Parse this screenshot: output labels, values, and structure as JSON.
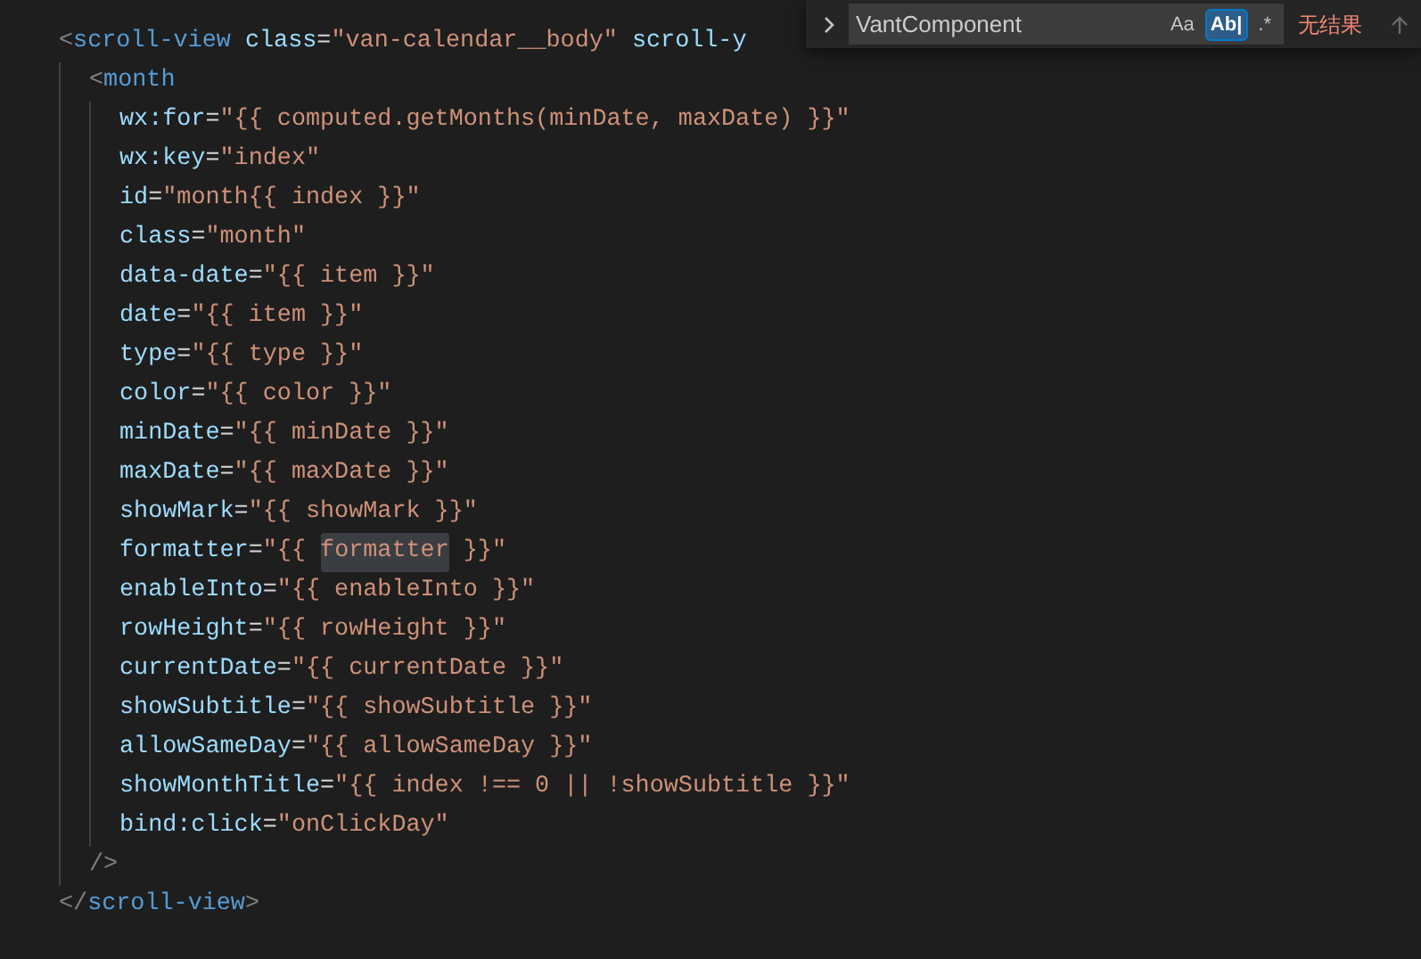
{
  "editor": {
    "lines": [
      {
        "tokens": [
          {
            "kind": "punct",
            "text": "<"
          },
          {
            "kind": "tag",
            "text": "scroll-view"
          },
          {
            "kind": "attr",
            "text": " class"
          },
          {
            "kind": "plain",
            "text": "="
          },
          {
            "kind": "string",
            "text": "\"van-calendar__body\""
          },
          {
            "kind": "attr",
            "text": " scroll-y"
          }
        ],
        "children": [
          {
            "tokens": [
              {
                "kind": "punct",
                "text": "<"
              },
              {
                "kind": "tag",
                "text": "month"
              }
            ],
            "children": [
              {
                "tokens": [
                  {
                    "kind": "attr",
                    "text": "wx:for"
                  },
                  {
                    "kind": "plain",
                    "text": "="
                  },
                  {
                    "kind": "string",
                    "text": "\"{{ computed.getMonths(minDate, maxDate) }}\""
                  }
                ]
              },
              {
                "tokens": [
                  {
                    "kind": "attr",
                    "text": "wx:key"
                  },
                  {
                    "kind": "plain",
                    "text": "="
                  },
                  {
                    "kind": "string",
                    "text": "\"index\""
                  }
                ]
              },
              {
                "tokens": [
                  {
                    "kind": "attr",
                    "text": "id"
                  },
                  {
                    "kind": "plain",
                    "text": "="
                  },
                  {
                    "kind": "string",
                    "text": "\"month{{ index }}\""
                  }
                ]
              },
              {
                "tokens": [
                  {
                    "kind": "attr",
                    "text": "class"
                  },
                  {
                    "kind": "plain",
                    "text": "="
                  },
                  {
                    "kind": "string",
                    "text": "\"month\""
                  }
                ]
              },
              {
                "tokens": [
                  {
                    "kind": "attr",
                    "text": "data-date"
                  },
                  {
                    "kind": "plain",
                    "text": "="
                  },
                  {
                    "kind": "string",
                    "text": "\"{{ item }}\""
                  }
                ]
              },
              {
                "tokens": [
                  {
                    "kind": "attr",
                    "text": "date"
                  },
                  {
                    "kind": "plain",
                    "text": "="
                  },
                  {
                    "kind": "string",
                    "text": "\"{{ item }}\""
                  }
                ]
              },
              {
                "tokens": [
                  {
                    "kind": "attr",
                    "text": "type"
                  },
                  {
                    "kind": "plain",
                    "text": "="
                  },
                  {
                    "kind": "string",
                    "text": "\"{{ type }}\""
                  }
                ]
              },
              {
                "tokens": [
                  {
                    "kind": "attr",
                    "text": "color"
                  },
                  {
                    "kind": "plain",
                    "text": "="
                  },
                  {
                    "kind": "string",
                    "text": "\"{{ color }}\""
                  }
                ]
              },
              {
                "tokens": [
                  {
                    "kind": "attr",
                    "text": "minDate"
                  },
                  {
                    "kind": "plain",
                    "text": "="
                  },
                  {
                    "kind": "string",
                    "text": "\"{{ minDate }}\""
                  }
                ]
              },
              {
                "tokens": [
                  {
                    "kind": "attr",
                    "text": "maxDate"
                  },
                  {
                    "kind": "plain",
                    "text": "="
                  },
                  {
                    "kind": "string",
                    "text": "\"{{ maxDate }}\""
                  }
                ]
              },
              {
                "tokens": [
                  {
                    "kind": "attr",
                    "text": "showMark"
                  },
                  {
                    "kind": "plain",
                    "text": "="
                  },
                  {
                    "kind": "string",
                    "text": "\"{{ showMark }}\""
                  }
                ]
              },
              {
                "tokens": [
                  {
                    "kind": "attr",
                    "text": "formatter"
                  },
                  {
                    "kind": "plain",
                    "text": "="
                  },
                  {
                    "kind": "string",
                    "text": "\"{{ "
                  },
                  {
                    "kind": "match",
                    "text": "formatter"
                  },
                  {
                    "kind": "string",
                    "text": " }}\""
                  }
                ]
              },
              {
                "tokens": [
                  {
                    "kind": "attr",
                    "text": "enableInto"
                  },
                  {
                    "kind": "plain",
                    "text": "="
                  },
                  {
                    "kind": "string",
                    "text": "\"{{ enableInto }}\""
                  }
                ]
              },
              {
                "tokens": [
                  {
                    "kind": "attr",
                    "text": "rowHeight"
                  },
                  {
                    "kind": "plain",
                    "text": "="
                  },
                  {
                    "kind": "string",
                    "text": "\"{{ rowHeight }}\""
                  }
                ]
              },
              {
                "tokens": [
                  {
                    "kind": "attr",
                    "text": "currentDate"
                  },
                  {
                    "kind": "plain",
                    "text": "="
                  },
                  {
                    "kind": "string",
                    "text": "\"{{ currentDate }}\""
                  }
                ]
              },
              {
                "tokens": [
                  {
                    "kind": "attr",
                    "text": "showSubtitle"
                  },
                  {
                    "kind": "plain",
                    "text": "="
                  },
                  {
                    "kind": "string",
                    "text": "\"{{ showSubtitle }}\""
                  }
                ]
              },
              {
                "tokens": [
                  {
                    "kind": "attr",
                    "text": "allowSameDay"
                  },
                  {
                    "kind": "plain",
                    "text": "="
                  },
                  {
                    "kind": "string",
                    "text": "\"{{ allowSameDay }}\""
                  }
                ]
              },
              {
                "tokens": [
                  {
                    "kind": "attr",
                    "text": "showMonthTitle"
                  },
                  {
                    "kind": "plain",
                    "text": "="
                  },
                  {
                    "kind": "string",
                    "text": "\"{{ index !== 0 || !showSubtitle }}\""
                  }
                ]
              },
              {
                "tokens": [
                  {
                    "kind": "attr",
                    "text": "bind:click"
                  },
                  {
                    "kind": "plain",
                    "text": "="
                  },
                  {
                    "kind": "string",
                    "text": "\"onClickDay\""
                  }
                ]
              }
            ]
          },
          {
            "tokens": [
              {
                "kind": "punct",
                "text": "/>"
              }
            ]
          }
        ]
      },
      {
        "tokens": [
          {
            "kind": "punct",
            "text": "</"
          },
          {
            "kind": "tag",
            "text": "scroll-view"
          },
          {
            "kind": "punct",
            "text": ">"
          }
        ]
      }
    ]
  },
  "find_widget": {
    "expanded": false,
    "value": "VantComponent",
    "options": [
      {
        "label": "Aa",
        "selected": false
      },
      {
        "label": "Ab|",
        "selected": true
      },
      {
        "label": ".*",
        "selected": false
      }
    ],
    "result": "无结果"
  }
}
